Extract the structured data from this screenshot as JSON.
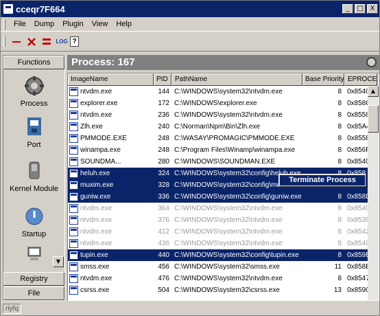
{
  "window": {
    "title": "cceqr7F664",
    "min_glyph": "_",
    "max_glyph": "□",
    "close_glyph": "X"
  },
  "menu": [
    "File",
    "Dump",
    "Plugin",
    "View",
    "Help"
  ],
  "toolbar": {
    "log_label": "LOG",
    "help_glyph": "?"
  },
  "sidebar": {
    "header": "Functions",
    "items": [
      {
        "label": "Process",
        "icon": "gear-icon"
      },
      {
        "label": "Port",
        "icon": "port-icon"
      },
      {
        "label": "Kernel Module",
        "icon": "kernel-icon"
      },
      {
        "label": "Startup",
        "icon": "startup-icon"
      }
    ],
    "bottom": [
      "Registry",
      "File"
    ]
  },
  "panel": {
    "title": "Process: 167"
  },
  "table": {
    "columns": [
      "ImageName",
      "PID",
      "PathName",
      "Base Priority",
      "EPROCE"
    ],
    "rows": [
      {
        "name": "ntvdm.exe",
        "pid": "144",
        "path": "C:\\WINDOWS\\system32\\ntvdm.exe",
        "prio": "8",
        "ep": "0x8540F",
        "state": ""
      },
      {
        "name": "explorer.exe",
        "pid": "172",
        "path": "C:\\WINDOWS\\explorer.exe",
        "prio": "8",
        "ep": "0x858CF",
        "state": ""
      },
      {
        "name": "ntvdm.exe",
        "pid": "236",
        "path": "C:\\WINDOWS\\system32\\ntvdm.exe",
        "prio": "8",
        "ep": "0x8558",
        "state": ""
      },
      {
        "name": "Zlh.exe",
        "pid": "240",
        "path": "C:\\Norman\\Npm\\Bin\\Zlh.exe",
        "prio": "8",
        "ep": "0x85A4",
        "state": ""
      },
      {
        "name": "PMMODE.EXE",
        "pid": "248",
        "path": "C:\\WASAY\\PROMAGIC\\PMMODE.EXE",
        "prio": "8",
        "ep": "0x8558",
        "state": ""
      },
      {
        "name": "winampa.exe",
        "pid": "248",
        "path": "C:\\Program Files\\Winamp\\winampa.exe",
        "prio": "8",
        "ep": "0x856F",
        "state": ""
      },
      {
        "name": "SOUNDMA...",
        "pid": "280",
        "path": "C:\\WINDOWS\\SOUNDMAN.EXE",
        "prio": "8",
        "ep": "0x8540",
        "state": ""
      },
      {
        "name": "heluh.exe",
        "pid": "324",
        "path": "C:\\WINDOWS\\system32\\config\\heluh.exe",
        "prio": "8",
        "ep": "0x858",
        "state": "sel"
      },
      {
        "name": "muxim.exe",
        "pid": "328",
        "path": "C:\\WINDOWS\\system32\\config\\muxim.exe",
        "prio": "8",
        "ep": "0x858",
        "state": "sel"
      },
      {
        "name": "guniw.exe",
        "pid": "336",
        "path": "C:\\WINDOWS\\system32\\config\\guniw.exe",
        "prio": "8",
        "ep": "0x858D",
        "state": "sel"
      },
      {
        "name": "ntvdm.exe",
        "pid": "364",
        "path": "C:\\WINDOWS\\system32\\ntvdm.exe",
        "prio": "8",
        "ep": "0x8540",
        "state": "dim"
      },
      {
        "name": "ntvdm.exe",
        "pid": "376",
        "path": "C:\\WINDOWS\\system32\\ntvdm.exe",
        "prio": "8",
        "ep": "0x8539",
        "state": "dim"
      },
      {
        "name": "ntvdm.exe",
        "pid": "412",
        "path": "C:\\WINDOWS\\system32\\ntvdm.exe",
        "prio": "8",
        "ep": "0x8542",
        "state": "dim"
      },
      {
        "name": "ntvdm.exe",
        "pid": "436",
        "path": "C:\\WINDOWS\\system32\\ntvdm.exe",
        "prio": "8",
        "ep": "0x8540",
        "state": "dim"
      },
      {
        "name": "tupin.exe",
        "pid": "440",
        "path": "C:\\WINDOWS\\system32\\config\\tupin.exe",
        "prio": "8",
        "ep": "0x859B",
        "state": "sel"
      },
      {
        "name": "smss.exe",
        "pid": "456",
        "path": "C:\\WINDOWS\\system32\\smss.exe",
        "prio": "11",
        "ep": "0x858E",
        "state": ""
      },
      {
        "name": "ntvdm.exe",
        "pid": "476",
        "path": "C:\\WINDOWS\\system32\\ntvdm.exe",
        "prio": "8",
        "ep": "0x8547",
        "state": ""
      },
      {
        "name": "csrss.exe",
        "pid": "504",
        "path": "C:\\WINDOWS\\system32\\csrss.exe",
        "prio": "13",
        "ep": "0x8590",
        "state": ""
      }
    ]
  },
  "context_menu": {
    "item": "Terminate Process"
  },
  "status": {
    "text": "riyfq"
  }
}
